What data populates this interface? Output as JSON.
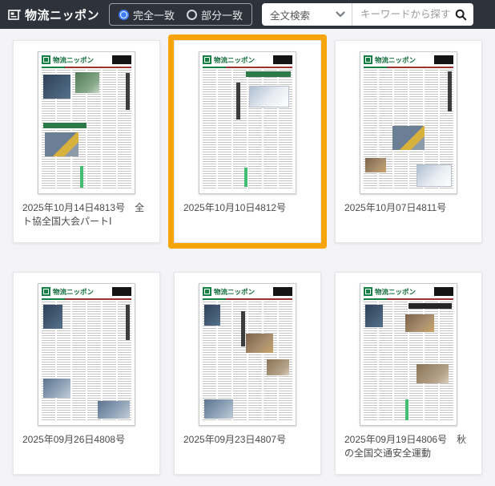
{
  "header": {
    "logo_text": "物流ニッポン",
    "radio_exact_label": "完全一致",
    "radio_partial_label": "部分一致",
    "radio_selected": "完全一致",
    "select_value": "全文検索",
    "search_placeholder": "キーワードから探す"
  },
  "colors": {
    "header_bg": "#2e323a",
    "highlight_orange": "#f7a50a",
    "radio_blue": "#3d7ef7",
    "masthead_green": "#158045",
    "page_bg": "#f4f3f6"
  },
  "thumbnail": {
    "masthead": "物流ニッポン"
  },
  "cards": [
    {
      "caption": "2025年10月14日4813号　全ト協全国大会パートⅠ",
      "highlighted": false
    },
    {
      "caption": "2025年10月10日4812号",
      "highlighted": true
    },
    {
      "caption": "2025年10月07日4811号",
      "highlighted": false
    },
    {
      "caption": "2025年09月26日4808号",
      "highlighted": false
    },
    {
      "caption": "2025年09月23日4807号",
      "highlighted": false
    },
    {
      "caption": "2025年09月19日4806号　秋の全国交通安全運動",
      "highlighted": false
    }
  ]
}
